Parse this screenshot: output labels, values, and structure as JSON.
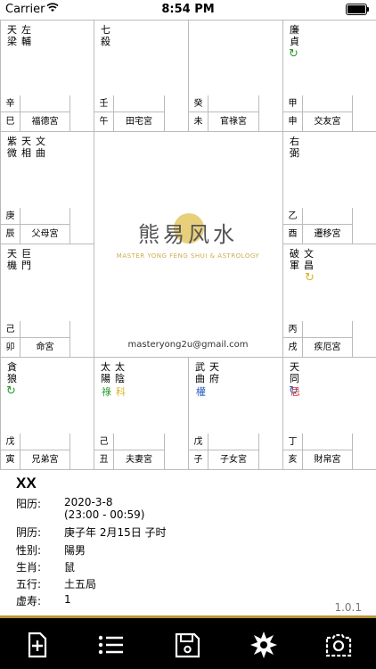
{
  "status": {
    "carrier": "Carrier",
    "time": "8:54 PM"
  },
  "cells": [
    {
      "id": "si",
      "stars": [
        [
          "天",
          "梁"
        ],
        [
          "左",
          "輔"
        ]
      ],
      "cycle": null,
      "hua": [],
      "gan": "辛",
      "zhi": "巳",
      "palace": "福德宮"
    },
    {
      "id": "wu",
      "stars": [
        [
          "七",
          "殺"
        ]
      ],
      "cycle": null,
      "hua": [],
      "gan": "壬",
      "zhi": "午",
      "palace": "田宅宮"
    },
    {
      "id": "wei",
      "stars": [],
      "cycle": null,
      "hua": [],
      "gan": "癸",
      "zhi": "未",
      "palace": "官祿宮"
    },
    {
      "id": "shen",
      "stars": [
        [
          "廉",
          "貞"
        ]
      ],
      "cycle": "green",
      "hua": [],
      "gan": "甲",
      "zhi": "申",
      "palace": "交友宮"
    },
    {
      "id": "chen",
      "stars": [
        [
          "紫",
          "微"
        ],
        [
          "天",
          "相"
        ],
        [
          "文",
          "曲"
        ]
      ],
      "cycle": null,
      "hua": [],
      "gan": "庚",
      "zhi": "辰",
      "palace": "父母宮"
    },
    {
      "id": "you",
      "stars": [
        [
          "右",
          "弼"
        ]
      ],
      "cycle": null,
      "hua": [],
      "gan": "乙",
      "zhi": "酉",
      "palace": "遷移宮"
    },
    {
      "id": "mao",
      "stars": [
        [
          "天",
          "機"
        ],
        [
          "巨",
          "門"
        ]
      ],
      "cycle": null,
      "hua": [],
      "gan": "己",
      "zhi": "卯",
      "palace": "命宮"
    },
    {
      "id": "xu",
      "stars": [
        [
          "破",
          "軍"
        ],
        [
          "文",
          "昌"
        ]
      ],
      "cycle": "yellow",
      "hua": [],
      "gan": "丙",
      "zhi": "戌",
      "palace": "疾厄宮"
    },
    {
      "id": "yin",
      "stars": [
        [
          "貪",
          "狼"
        ]
      ],
      "cycle": "green",
      "hua": [],
      "gan": "戊",
      "zhi": "寅",
      "palace": "兄弟宮"
    },
    {
      "id": "chou",
      "stars": [
        [
          "太",
          "陽"
        ],
        [
          "太",
          "陰"
        ]
      ],
      "cycle": null,
      "hua": [
        {
          "t": "祿",
          "c": "#2b9a2b"
        },
        {
          "t": "科",
          "c": "#d9b325"
        }
      ],
      "gan": "己",
      "zhi": "丑",
      "palace": "夫妻宮"
    },
    {
      "id": "zi",
      "stars": [
        [
          "武",
          "曲"
        ],
        [
          "天",
          "府"
        ]
      ],
      "cycle": null,
      "hua": [
        {
          "t": "權",
          "c": "#2a5bc0"
        }
      ],
      "gan": "戊",
      "zhi": "子",
      "palace": "子女宮"
    },
    {
      "id": "hai",
      "stars": [
        [
          "天",
          "同"
        ]
      ],
      "cycle": "blue",
      "hua": [
        {
          "t": "忌",
          "c": "#d43030"
        }
      ],
      "gan": "丁",
      "zhi": "亥",
      "palace": "財帛宮"
    }
  ],
  "center": {
    "logo_cn": "熊易风水",
    "logo_en": "MASTER YONG FENG SHUI & ASTROLOGY",
    "email": "masteryong2u@gmail.com"
  },
  "info": {
    "name": "XX",
    "rows": [
      {
        "k": "阳历:",
        "v": "2020-3-8"
      },
      {
        "k": "",
        "v": "(23:00 - 00:59)"
      },
      {
        "k": "阴历:",
        "v": "庚子年 2月15日 子时"
      },
      {
        "k": "性别:",
        "v": "陽男"
      },
      {
        "k": "生肖:",
        "v": "鼠"
      },
      {
        "k": "五行:",
        "v": "土五局"
      },
      {
        "k": "虚寿:",
        "v": "1"
      }
    ],
    "version": "1.0.1"
  },
  "toolbar": [
    "add-document-icon",
    "list-icon",
    "save-icon",
    "star-burst-icon",
    "camera-icon"
  ],
  "colors": {
    "cycle_green": "#2b9a2b",
    "cycle_blue": "#2a5bc0",
    "cycle_yellow": "#d9b325",
    "toolbar_bg": "#000000",
    "toolbar_accent": "#b8963e"
  }
}
